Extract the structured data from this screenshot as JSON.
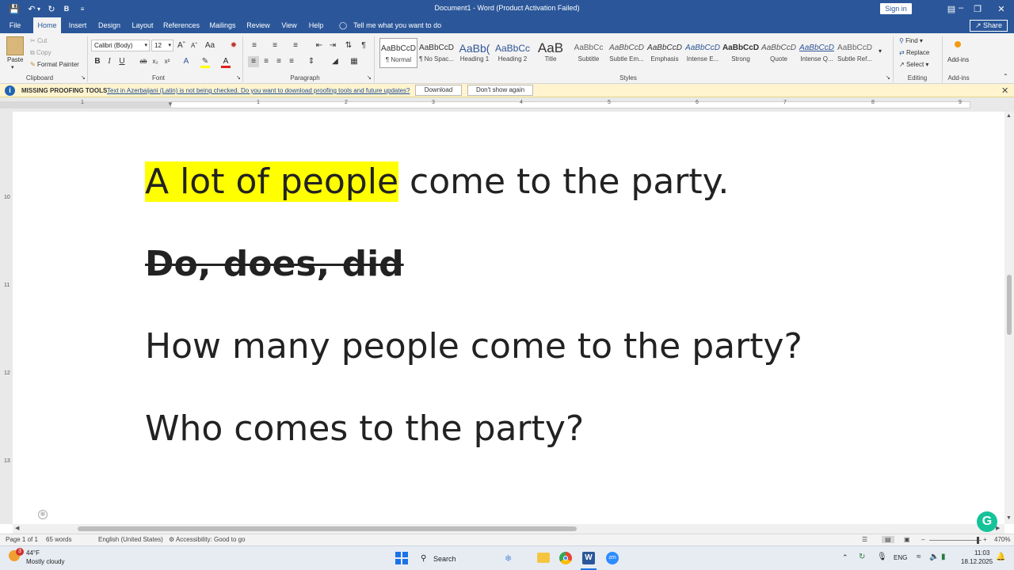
{
  "titlebar": {
    "title": "Document1 - Word (Product Activation Failed)",
    "sign_in": "Sign in"
  },
  "tabs": [
    "File",
    "Home",
    "Insert",
    "Design",
    "Layout",
    "References",
    "Mailings",
    "Review",
    "View",
    "Help"
  ],
  "tell_me": "Tell me what you want to do",
  "share": "Share",
  "ribbon": {
    "clipboard": {
      "paste": "Paste",
      "cut": "Cut",
      "copy": "Copy",
      "format_painter": "Format Painter",
      "label": "Clipboard"
    },
    "font": {
      "name": "Calibri (Body)",
      "size": "12",
      "label": "Font"
    },
    "paragraph": {
      "label": "Paragraph"
    },
    "styles": {
      "label": "Styles",
      "items": [
        {
          "preview": "AaBbCcD",
          "name": "¶ Normal"
        },
        {
          "preview": "AaBbCcD",
          "name": "¶ No Spac..."
        },
        {
          "preview": "AaBb(",
          "name": "Heading 1"
        },
        {
          "preview": "AaBbCc",
          "name": "Heading 2"
        },
        {
          "preview": "AaB",
          "name": "Title"
        },
        {
          "preview": "AaBbCc",
          "name": "Subtitle"
        },
        {
          "preview": "AaBbCcD",
          "name": "Subtle Em..."
        },
        {
          "preview": "AaBbCcD",
          "name": "Emphasis"
        },
        {
          "preview": "AaBbCcD",
          "name": "Intense E..."
        },
        {
          "preview": "AaBbCcD",
          "name": "Strong"
        },
        {
          "preview": "AaBbCcD",
          "name": "Quote"
        },
        {
          "preview": "AaBbCcD",
          "name": "Intense Q..."
        },
        {
          "preview": "AaBbCcD",
          "name": "Subtle Ref..."
        }
      ]
    },
    "editing": {
      "find": "Find",
      "replace": "Replace",
      "select": "Select",
      "label": "Editing"
    },
    "addins": {
      "name": "Add-ins",
      "label": "Add-ins"
    }
  },
  "infobar": {
    "title": "MISSING PROOFING TOOLS",
    "message": "Text in Azerbaijani (Latin) is not being checked. Do you want to download proofing tools and future updates?",
    "download": "Download",
    "dont_show": "Don't show again"
  },
  "ruler": {
    "h_numbers": [
      "1",
      "1",
      "2",
      "3",
      "4",
      "5",
      "6",
      "7",
      "8",
      "9"
    ],
    "v_numbers": [
      "10",
      "11",
      "12",
      "13"
    ]
  },
  "document": {
    "line1_highlight": "A lot of people",
    "line1_rest": " come to the party.",
    "line2": "Do, does, did",
    "line3": "How many people come to the party?",
    "line4": "Who comes to the party?"
  },
  "statusbar": {
    "page": "Page 1 of 1",
    "words": "65 words",
    "language": "English (United States)",
    "accessibility": "Accessibility: Good to go",
    "zoom": "470%"
  },
  "taskbar": {
    "weather_badge": "3",
    "temp": "44°F",
    "condition": "Mostly cloudy",
    "search": "Search",
    "lang": "ENG",
    "time": "11:03",
    "date": "18.12.2025"
  },
  "colors": {
    "brand": "#2b579a",
    "highlight": "#ffff00",
    "infobar": "#fff4ce"
  }
}
